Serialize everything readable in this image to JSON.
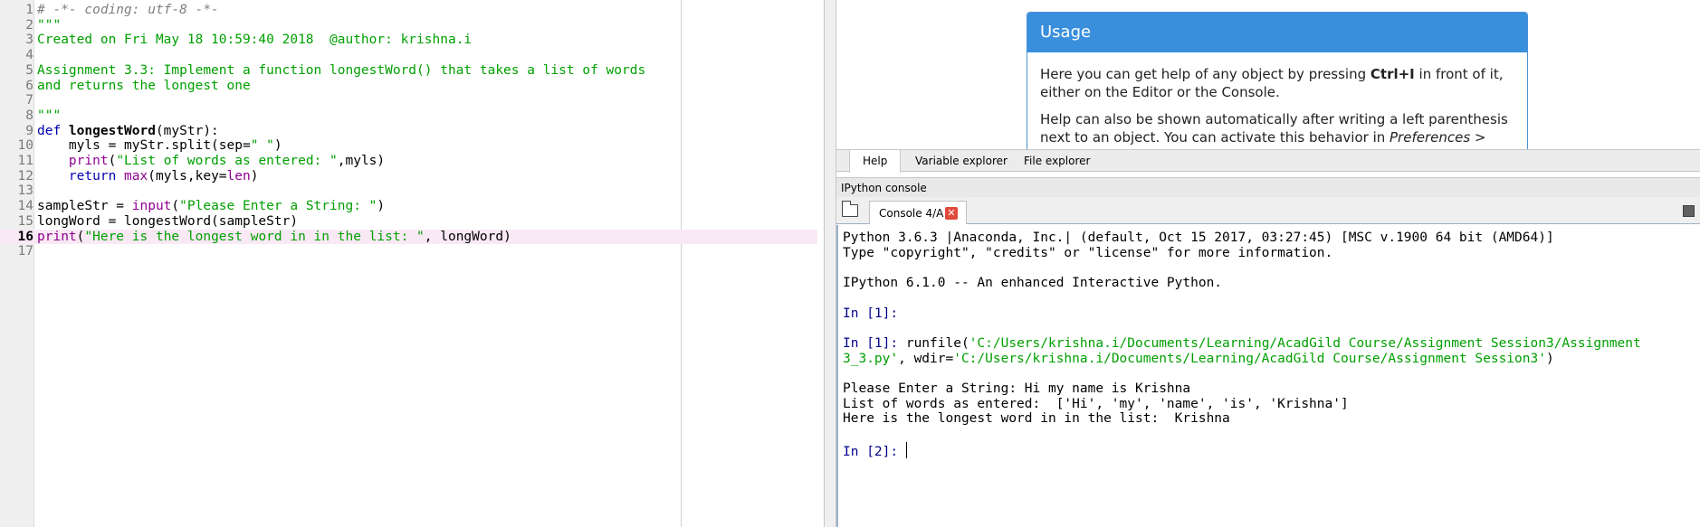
{
  "editor": {
    "lines": [
      {
        "n": "1",
        "segments": [
          {
            "cls": "c-comment",
            "text": "# -*- coding: utf-8 -*-"
          }
        ]
      },
      {
        "n": "2",
        "segments": [
          {
            "cls": "c-str",
            "text": "\"\"\""
          }
        ]
      },
      {
        "n": "3",
        "segments": [
          {
            "cls": "c-str",
            "text": "Created on Fri May 18 10:59:40 2018  @author: krishna.i"
          }
        ]
      },
      {
        "n": "4",
        "segments": []
      },
      {
        "n": "5",
        "segments": [
          {
            "cls": "c-str",
            "text": "Assignment 3.3: Implement a function longestWord() that takes a list of words"
          }
        ]
      },
      {
        "n": "6",
        "segments": [
          {
            "cls": "c-str",
            "text": "and returns the longest one"
          }
        ]
      },
      {
        "n": "7",
        "segments": []
      },
      {
        "n": "8",
        "segments": [
          {
            "cls": "c-str",
            "text": "\"\"\""
          }
        ]
      },
      {
        "n": "9",
        "segments": [
          {
            "cls": "c-kw",
            "text": "def "
          },
          {
            "cls": "c-def",
            "text": "longestWord"
          },
          {
            "cls": "",
            "text": "(myStr):"
          }
        ]
      },
      {
        "n": "10",
        "segments": [
          {
            "cls": "",
            "text": "    myls = myStr.split(sep="
          },
          {
            "cls": "c-str",
            "text": "\" \""
          },
          {
            "cls": "",
            "text": ")"
          }
        ]
      },
      {
        "n": "11",
        "segments": [
          {
            "cls": "",
            "text": "    "
          },
          {
            "cls": "c-builtin",
            "text": "print"
          },
          {
            "cls": "",
            "text": "("
          },
          {
            "cls": "c-str",
            "text": "\"List of words as entered: \""
          },
          {
            "cls": "",
            "text": ",myls)"
          }
        ]
      },
      {
        "n": "12",
        "segments": [
          {
            "cls": "",
            "text": "    "
          },
          {
            "cls": "c-kw",
            "text": "return "
          },
          {
            "cls": "c-builtin",
            "text": "max"
          },
          {
            "cls": "",
            "text": "(myls,key="
          },
          {
            "cls": "c-builtin",
            "text": "len"
          },
          {
            "cls": "",
            "text": ")"
          }
        ]
      },
      {
        "n": "13",
        "segments": []
      },
      {
        "n": "14",
        "segments": [
          {
            "cls": "",
            "text": "sampleStr = "
          },
          {
            "cls": "c-builtin",
            "text": "input"
          },
          {
            "cls": "",
            "text": "("
          },
          {
            "cls": "c-str",
            "text": "\"Please Enter a String: \""
          },
          {
            "cls": "",
            "text": ")"
          }
        ]
      },
      {
        "n": "15",
        "segments": [
          {
            "cls": "",
            "text": "longWord = longestWord(sampleStr)"
          }
        ]
      },
      {
        "n": "16",
        "segments": [
          {
            "cls": "c-builtin",
            "text": "print"
          },
          {
            "cls": "",
            "text": "("
          },
          {
            "cls": "c-str",
            "text": "\"Here is the longest word in in the list: \""
          },
          {
            "cls": "",
            "text": ", longWord)"
          }
        ],
        "current": true
      },
      {
        "n": "17",
        "segments": []
      }
    ]
  },
  "help": {
    "usage_title": "Usage",
    "para1_a": "Here you can get help of any object by pressing ",
    "para1_key": "Ctrl+I",
    "para1_b": " in front of it, either on the Editor or the Console.",
    "para2_a": "Help can also be shown automatically after writing a left parenthesis next to an object. You can activate this behavior in ",
    "para2_link": "Preferences >"
  },
  "pane_tabs": [
    "Help",
    "Variable explorer",
    "File explorer"
  ],
  "console": {
    "title": "IPython console",
    "tab_label": "Console 4/A",
    "lines": [
      [
        {
          "cls": "",
          "text": "Python 3.6.3 |Anaconda, Inc.| (default, Oct 15 2017, 03:27:45) [MSC v.1900 64 bit (AMD64)]"
        }
      ],
      [
        {
          "cls": "",
          "text": "Type \"copyright\", \"credits\" or \"license\" for more information."
        }
      ],
      [],
      [
        {
          "cls": "",
          "text": "IPython 6.1.0 -- An enhanced Interactive Python."
        }
      ],
      [],
      [
        {
          "cls": "p-in",
          "text": "In [1]:"
        }
      ],
      [],
      [
        {
          "cls": "p-in",
          "text": "In [1]: "
        },
        {
          "cls": "",
          "text": "runfile("
        },
        {
          "cls": "p-green",
          "text": "'C:/Users/krishna.i/Documents/Learning/AcadGild Course/Assignment Session3/Assignment"
        }
      ],
      [
        {
          "cls": "p-green",
          "text": "3_3.py'"
        },
        {
          "cls": "",
          "text": ", wdir="
        },
        {
          "cls": "p-green",
          "text": "'C:/Users/krishna.i/Documents/Learning/AcadGild Course/Assignment Session3'"
        },
        {
          "cls": "",
          "text": ")"
        }
      ],
      [],
      [
        {
          "cls": "",
          "text": "Please Enter a String: Hi my name is Krishna"
        }
      ],
      [
        {
          "cls": "",
          "text": "List of words as entered:  ['Hi', 'my', 'name', 'is', 'Krishna']"
        }
      ],
      [
        {
          "cls": "",
          "text": "Here is the longest word in in the list:  Krishna"
        }
      ],
      [],
      [
        {
          "cls": "p-in",
          "text": "In [2]: "
        }
      ]
    ]
  }
}
